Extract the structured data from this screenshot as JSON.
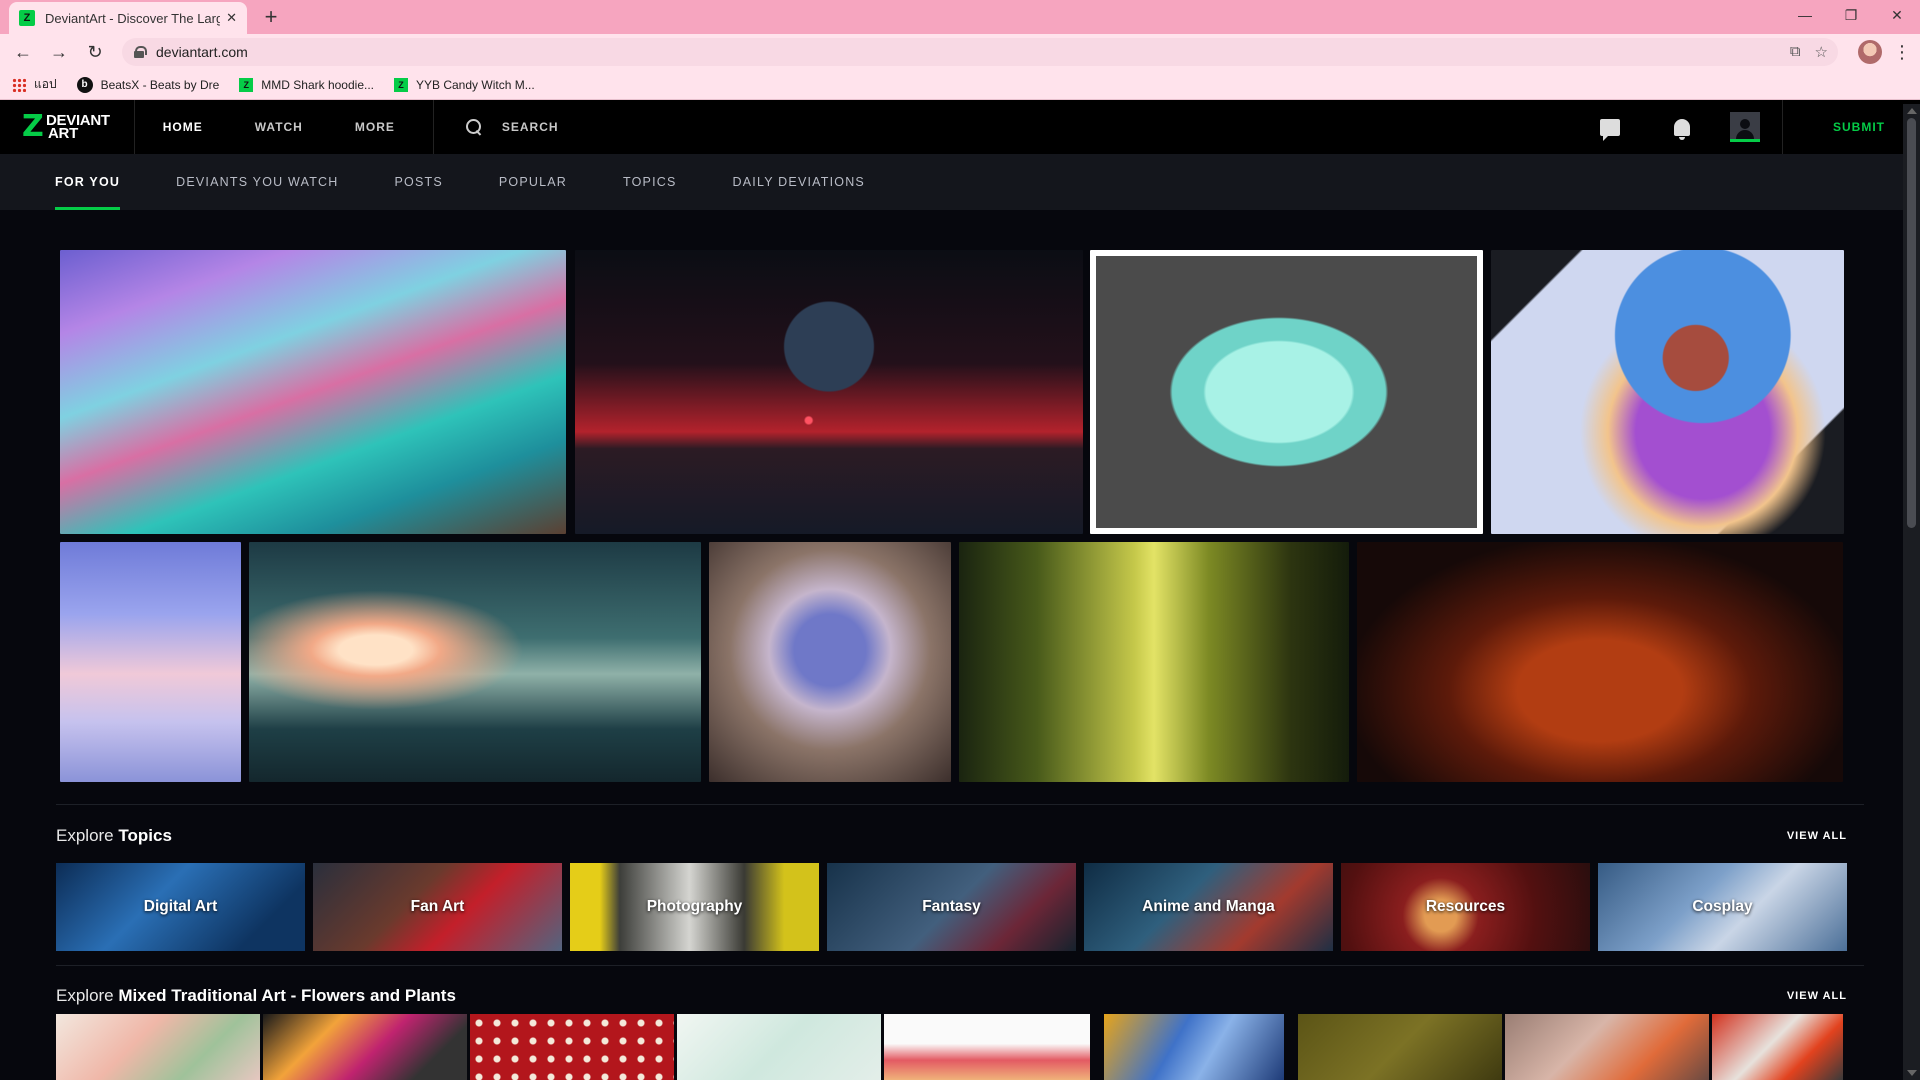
{
  "browser": {
    "tab_title": "DeviantArt - Discover The Larges",
    "tab_favicon": "Z",
    "url": "deviantart.com",
    "bookmarks": [
      {
        "label": "แอป",
        "icon": "apps-grid-icon"
      },
      {
        "label": "BeatsX - Beats by Dre",
        "icon": "beats-logo-icon"
      },
      {
        "label": "MMD Shark hoodie...",
        "icon": "deviantart-favicon-icon"
      },
      {
        "label": "YYB Candy Witch M...",
        "icon": "deviantart-favicon-icon"
      }
    ],
    "beats_icon_glyph": "b",
    "da_icon_glyph": "Z"
  },
  "header": {
    "logo_line1": "DEVIANT",
    "logo_line2": "ART",
    "logo_glyph": "Z",
    "nav": [
      "HOME",
      "WATCH",
      "MORE"
    ],
    "search_label": "SEARCH",
    "submit_label": "SUBMIT",
    "accent_color": "#05cc47"
  },
  "subnav": [
    "FOR YOU",
    "DEVIANTS YOU WATCH",
    "POSTS",
    "POPULAR",
    "TOPICS",
    "DAILY DEVIATIONS"
  ],
  "explore_topics": {
    "prefix": "Explore",
    "highlight": "Topics",
    "view_all": "VIEW ALL",
    "items": [
      "Digital Art",
      "Fan Art",
      "Photography",
      "Fantasy",
      "Anime and Manga",
      "Resources",
      "Cosplay"
    ]
  },
  "explore_category": {
    "prefix": "Explore",
    "highlight": "Mixed Traditional Art - Flowers and Plants",
    "view_all": "VIEW ALL"
  }
}
